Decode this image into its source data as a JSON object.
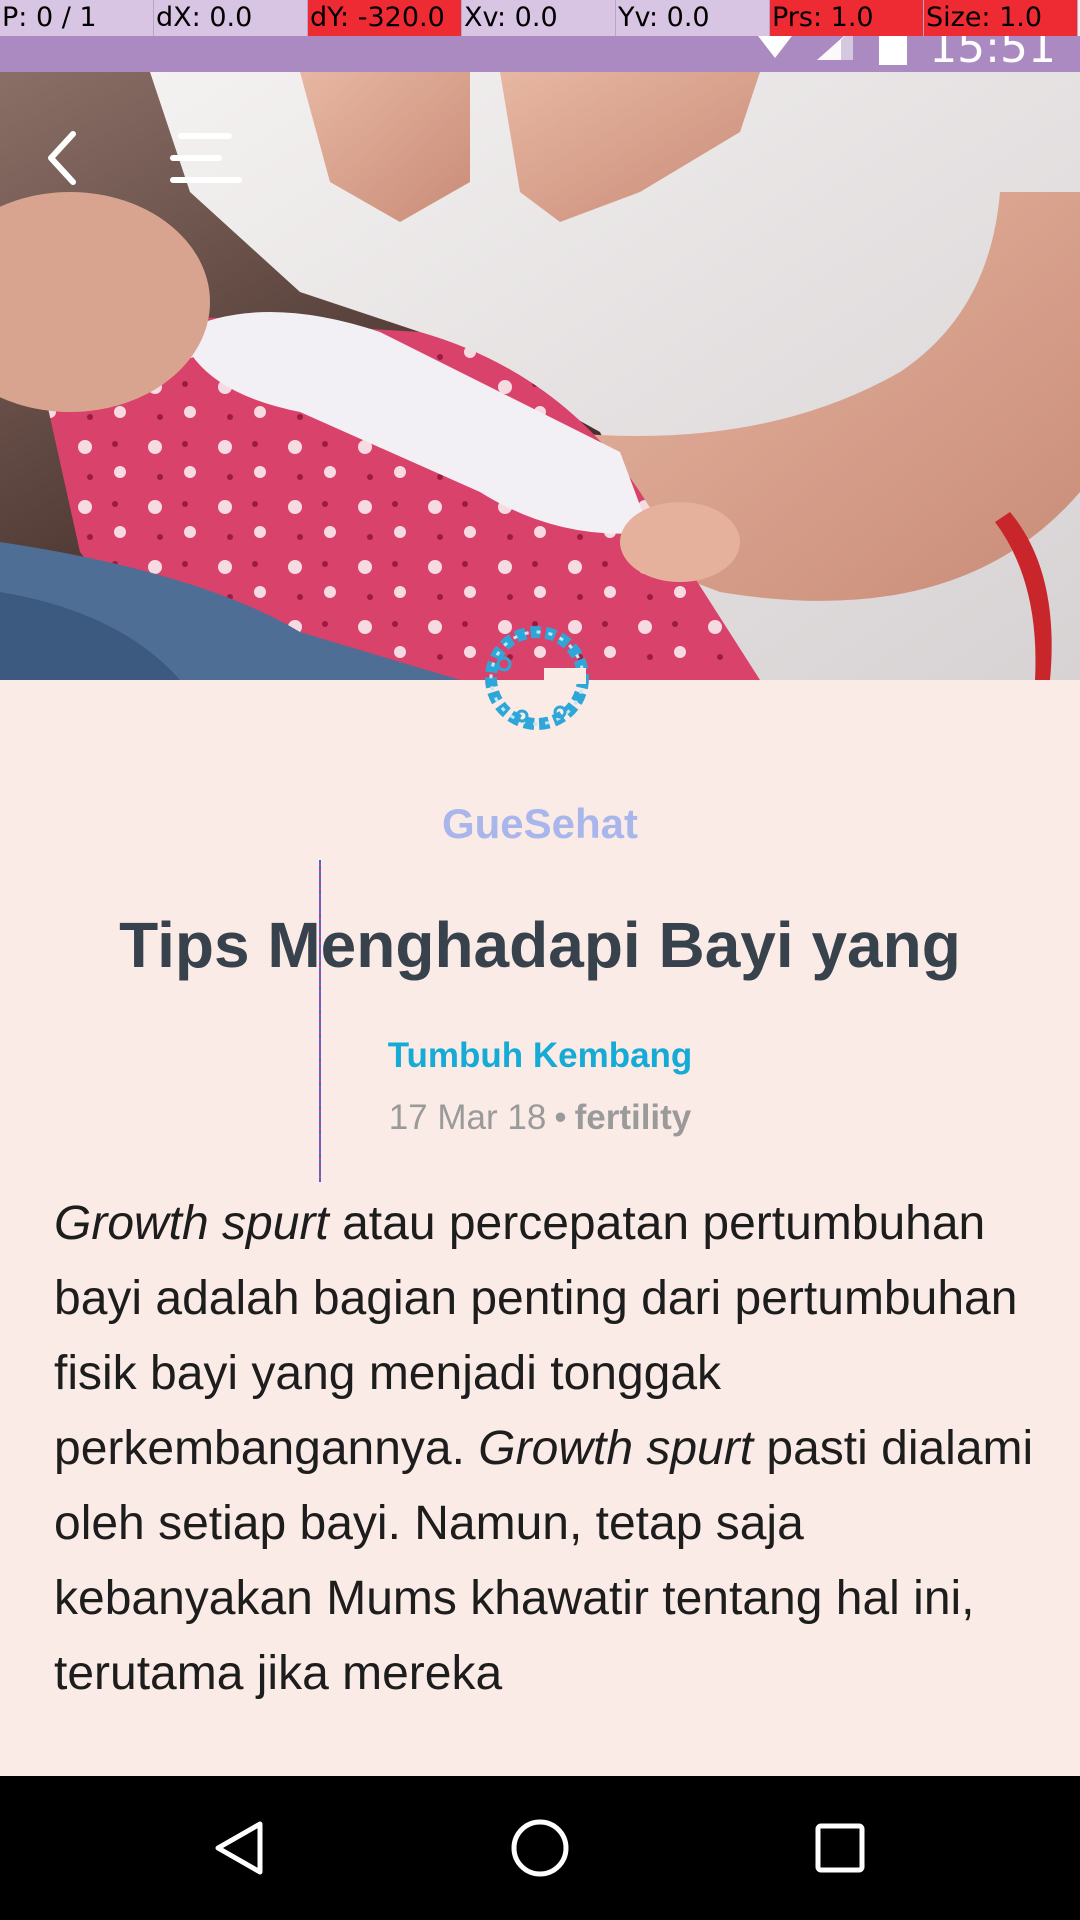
{
  "pointer_overlay": {
    "cells": [
      "P: 0 / 1",
      "dX: 0.0",
      "dY: -320.0",
      "Xv: 0.0",
      "Yv: 0.0",
      "Prs: 1.0",
      "Size: 1.0"
    ],
    "colors": {
      "normal": "#d8c4e3",
      "alert": "#ee2b33"
    }
  },
  "status_bar": {
    "time": "15:51",
    "icons": [
      "wifi-icon",
      "signal-icon",
      "battery-icon"
    ],
    "color": "#ab8ac2"
  },
  "header": {
    "back_icon": "back-chevron-icon",
    "menu_icon": "menu-icon"
  },
  "article": {
    "publisher": "GueSehat",
    "title": "Tips Menghadapi Bayi yang",
    "category": "Tumbuh Kembang",
    "date": "17 Mar 18",
    "separator": "•",
    "tag": "fertility",
    "body": {
      "em1": "Growth spurt",
      "text1": " atau percepatan pertumbuhan bayi adalah bagian penting dari pertumbuhan fisik bayi yang menjadi tonggak perkembangannya. ",
      "em2": "Growth spurt",
      "text2": " pasti dialami oleh setiap bayi. Namun, tetap saja kebanyakan Mums khawatir tentang hal ini, terutama jika mereka"
    }
  },
  "nav_bar": {
    "buttons": [
      "back-triangle-icon",
      "home-circle-icon",
      "recents-square-icon"
    ]
  },
  "colors": {
    "background": "#fbebe6",
    "publisher": "#a9b6ec",
    "title": "#37424c",
    "category": "#16aad6",
    "meta": "#9a9a9a"
  }
}
